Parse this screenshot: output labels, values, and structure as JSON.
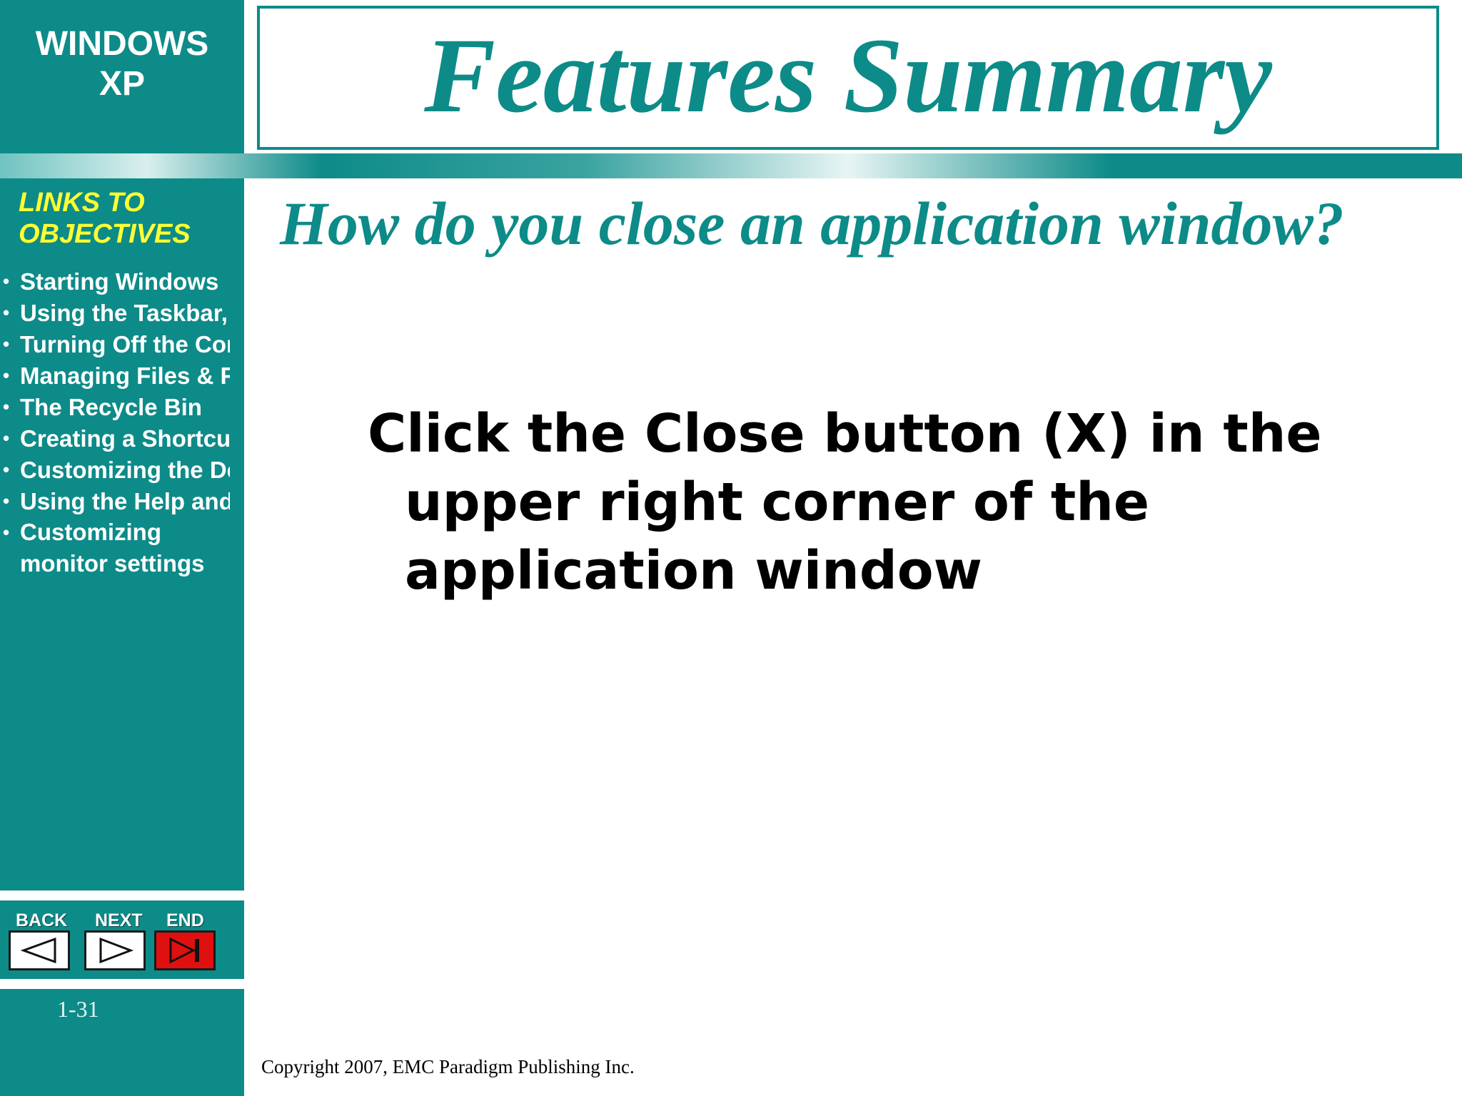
{
  "sidebar": {
    "brand_line1": "WINDOWS",
    "brand_line2": "XP",
    "links_heading_line1": "LINKS TO",
    "links_heading_line2": "OBJECTIVES",
    "links": [
      "Starting Windows",
      "Using the Taskbar, o",
      "Turning Off the Com",
      "Managing Files & Fol",
      "The Recycle Bin",
      "Creating a Shortcut",
      "Customizing the Des",
      "Using the Help and S",
      "Customizing monitor settings"
    ],
    "nav": {
      "back_label": "BACK",
      "next_label": "NEXT",
      "end_label": "END"
    },
    "page_number": "1-31"
  },
  "slide": {
    "title": "Features Summary",
    "question": "How do you close an application window?",
    "answer": "Click the Close button (X) in the upper right corner of the application window"
  },
  "footer": {
    "copyright": "Copyright 2007, EMC Paradigm Publishing Inc."
  },
  "colors": {
    "teal": "#0d8b88",
    "heading_yellow": "#ffff33",
    "end_red": "#e01010"
  },
  "icons": {
    "back": "triangle-left-icon",
    "next": "triangle-right-icon",
    "end": "skip-to-end-icon"
  }
}
